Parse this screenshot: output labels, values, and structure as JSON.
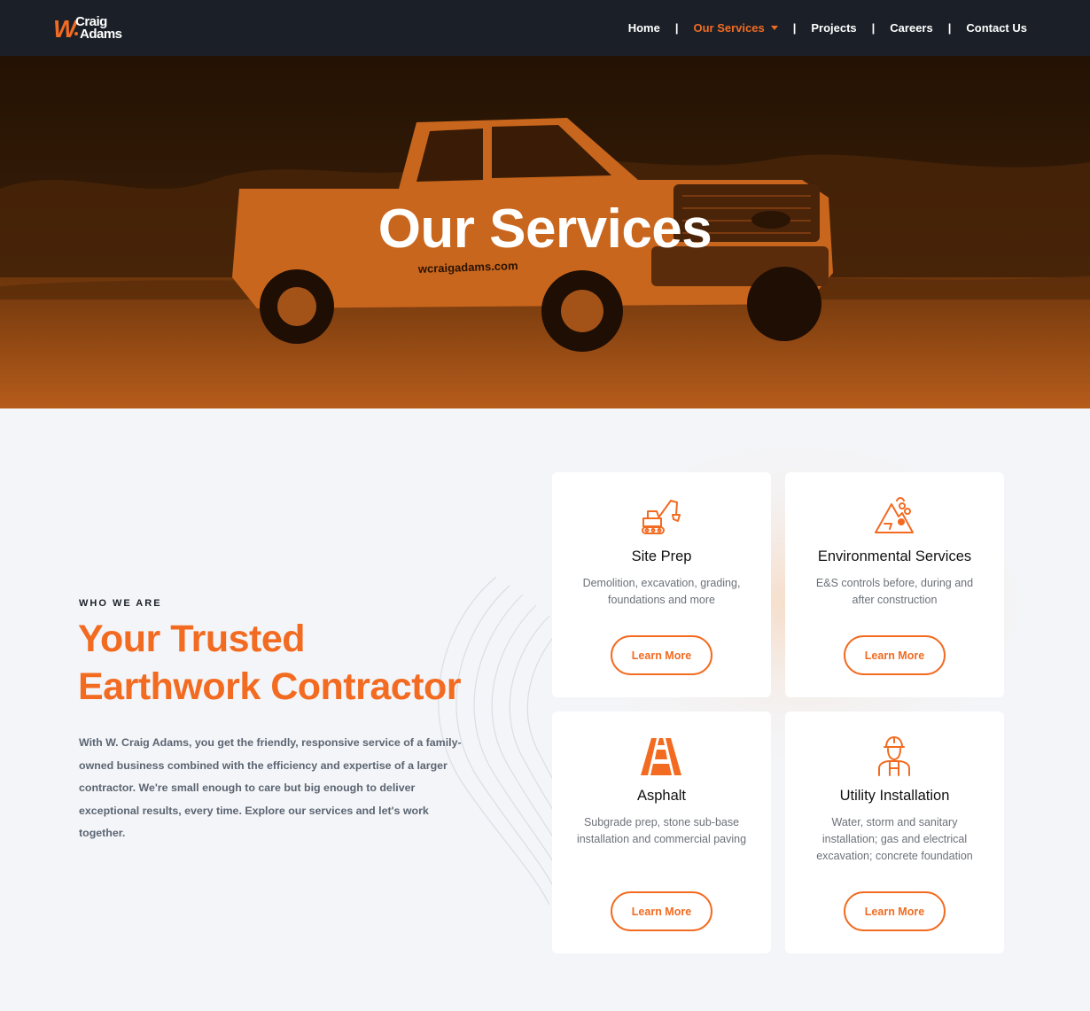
{
  "brand": {
    "logo_w": "W",
    "logo_top": "Craig",
    "logo_bottom": "Adams",
    "accent_color": "#f26b21",
    "nav_bg": "#1b2028"
  },
  "nav": {
    "items": [
      {
        "label": "Home"
      },
      {
        "label": "Our Services",
        "active": true
      },
      {
        "label": "Projects"
      },
      {
        "label": "Careers"
      },
      {
        "label": "Contact Us"
      }
    ],
    "separator": "|"
  },
  "hero": {
    "title": "Our Services",
    "truck_text": "wcraigadams.com"
  },
  "intro": {
    "eyebrow": "WHO WE ARE",
    "headline_line1": "Your Trusted",
    "headline_line2": "Earthwork Contractor",
    "body": "With W. Craig Adams, you get the friendly, responsive service of a family-owned business combined with the efficiency and expertise of a larger contractor. We're small enough to care but big enough to deliver exceptional results, every time. Explore our services and let's work together."
  },
  "services": [
    {
      "icon": "excavator-icon",
      "title": "Site Prep",
      "desc": "Demolition, excavation, grading, foundations and more",
      "button": "Learn More"
    },
    {
      "icon": "environment-icon",
      "title": "Environmental Services",
      "desc": "E&S controls before, during and after construction",
      "button": "Learn More"
    },
    {
      "icon": "road-icon",
      "title": "Asphalt",
      "desc": "Subgrade prep, stone sub-base installation and commercial paving",
      "button": "Learn More"
    },
    {
      "icon": "worker-icon",
      "title": "Utility Installation",
      "desc": "Water, storm and sanitary installation; gas and electrical excavation; concrete foundation",
      "button": "Learn More"
    }
  ]
}
